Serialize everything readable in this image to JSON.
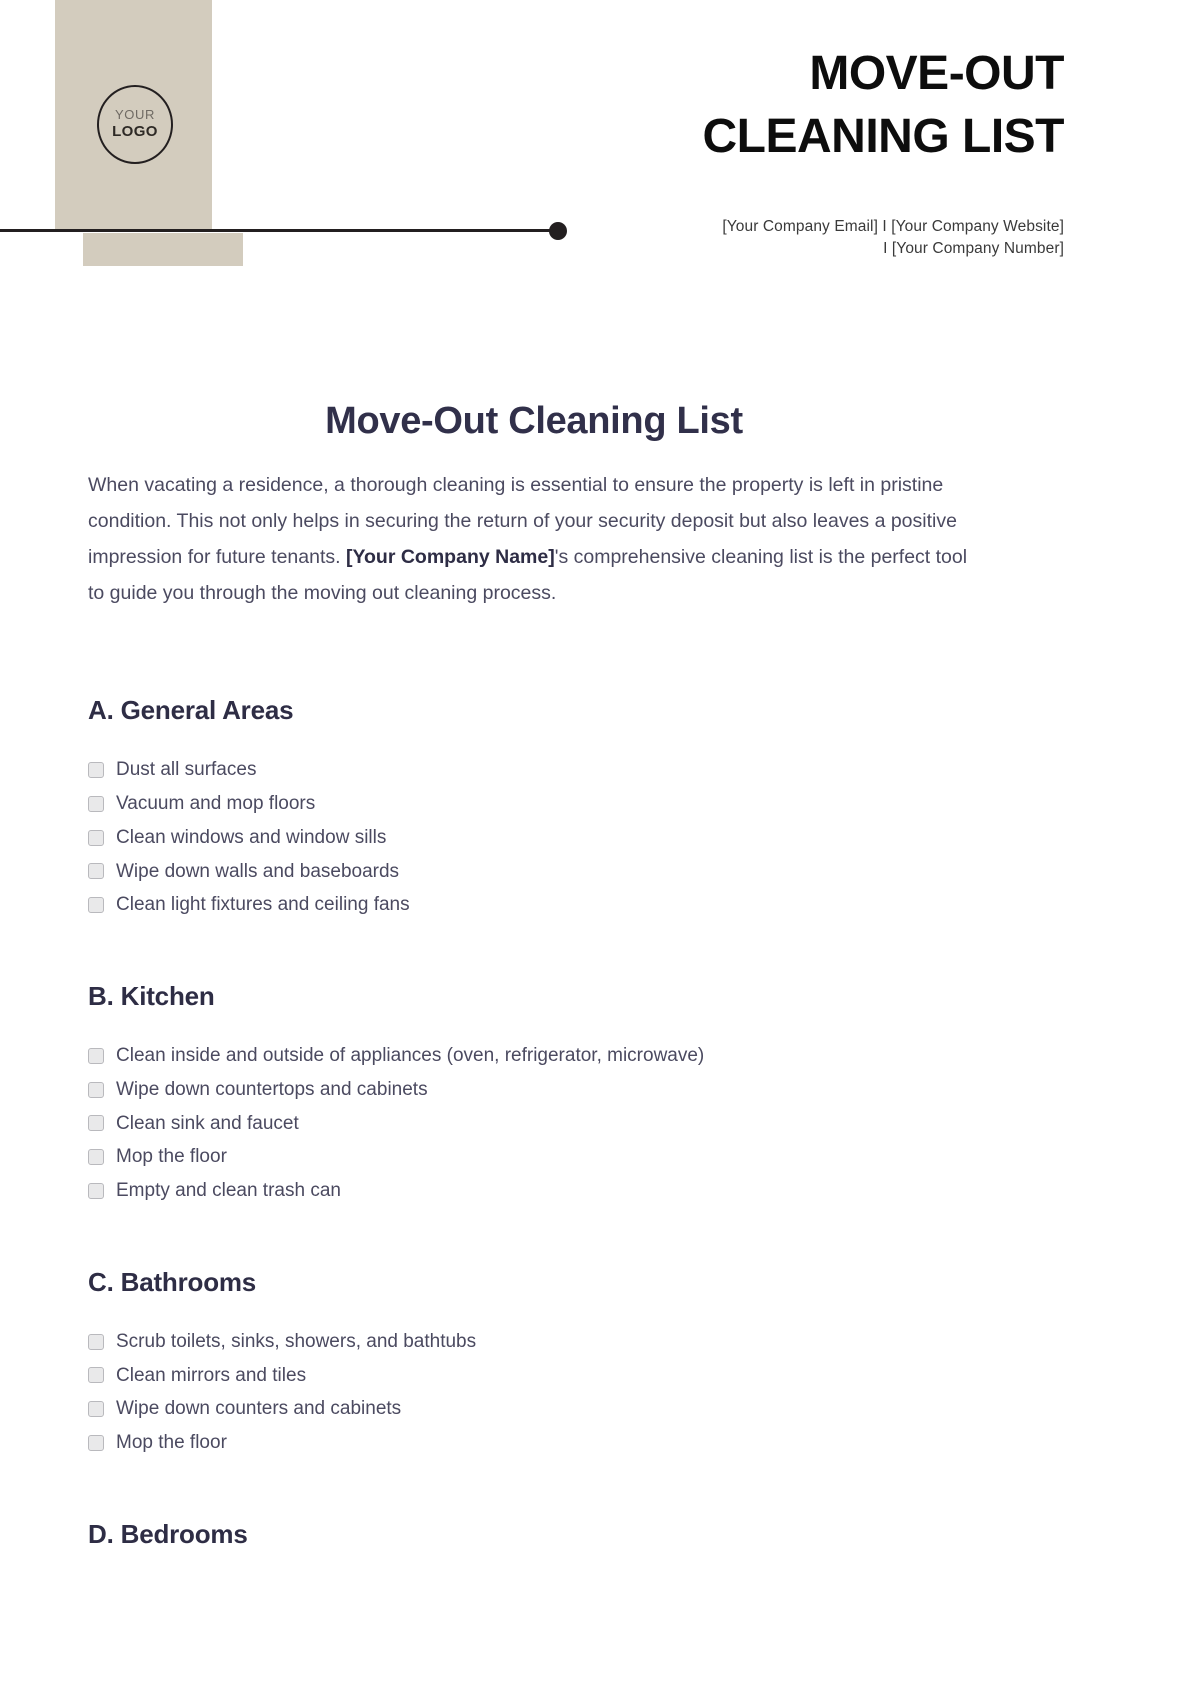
{
  "header": {
    "logo": {
      "line1": "YOUR",
      "line2": "LOGO"
    },
    "title_line1": "MOVE-OUT",
    "title_line2": "CLEANING LIST",
    "contact_line1": "[Your Company Email] I [Your Company Website]",
    "contact_line2": "I [Your Company Number]"
  },
  "document": {
    "title": "Move-Out Cleaning List",
    "intro_part1": "When vacating a residence, a thorough cleaning is essential to ensure the property is left in pristine condition. This not only helps in securing the return of your security deposit but also leaves a positive impression for future tenants. ",
    "intro_company": "[Your Company Name]",
    "intro_part2": "'s comprehensive cleaning list is the perfect tool to guide you through the moving out cleaning process."
  },
  "sections": [
    {
      "heading": "A. General Areas",
      "items": [
        "Dust all surfaces",
        "Vacuum and mop floors",
        "Clean windows and window sills",
        "Wipe down walls and baseboards",
        "Clean light fixtures and ceiling fans"
      ]
    },
    {
      "heading": "B. Kitchen",
      "items": [
        "Clean inside and outside of appliances (oven, refrigerator, microwave)",
        "Wipe down countertops and cabinets",
        "Clean sink and faucet",
        "Mop the floor",
        "Empty and clean trash can"
      ]
    },
    {
      "heading": "C. Bathrooms",
      "items": [
        "Scrub toilets, sinks, showers, and bathtubs",
        "Clean mirrors and tiles",
        "Wipe down counters and cabinets",
        "Mop the floor"
      ]
    },
    {
      "heading": "D. Bedrooms",
      "items": []
    }
  ],
  "colors": {
    "beige_block": "#d3ccbe",
    "rule_line": "#231f20",
    "heading_text": "#2e2d45",
    "body_text": "#4b4a60",
    "checkbox_fill": "#e9e9ea",
    "checkbox_border": "#b9b9bd"
  }
}
